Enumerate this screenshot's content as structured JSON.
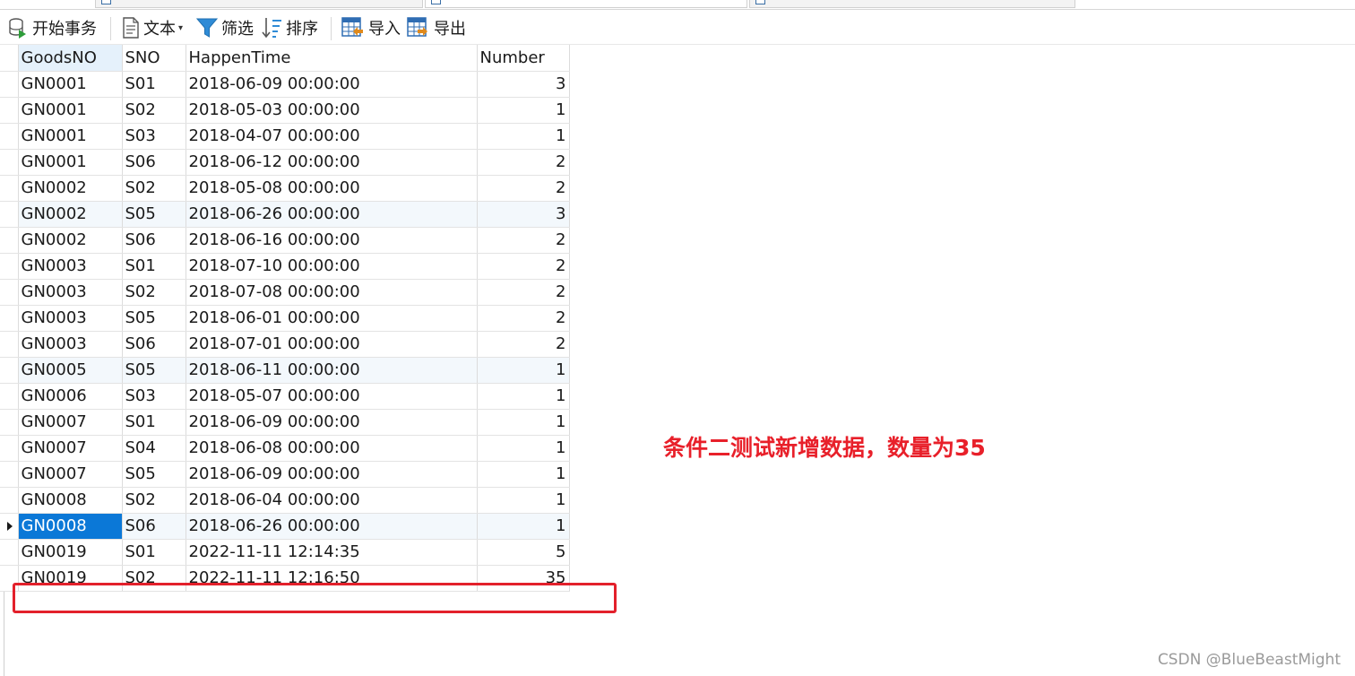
{
  "toolbar": {
    "begin_transaction": "开始事务",
    "text": "文本",
    "filter": "筛选",
    "sort": "排序",
    "import": "导入",
    "export": "导出"
  },
  "table": {
    "columns": [
      "GoodsNO",
      "SNO",
      "HappenTime",
      "Number"
    ],
    "rows": [
      [
        "GN0001",
        "S01",
        "2018-06-09 00:00:00",
        "3"
      ],
      [
        "GN0001",
        "S02",
        "2018-05-03 00:00:00",
        "1"
      ],
      [
        "GN0001",
        "S03",
        "2018-04-07 00:00:00",
        "1"
      ],
      [
        "GN0001",
        "S06",
        "2018-06-12 00:00:00",
        "2"
      ],
      [
        "GN0002",
        "S02",
        "2018-05-08 00:00:00",
        "2"
      ],
      [
        "GN0002",
        "S05",
        "2018-06-26 00:00:00",
        "3"
      ],
      [
        "GN0002",
        "S06",
        "2018-06-16 00:00:00",
        "2"
      ],
      [
        "GN0003",
        "S01",
        "2018-07-10 00:00:00",
        "2"
      ],
      [
        "GN0003",
        "S02",
        "2018-07-08 00:00:00",
        "2"
      ],
      [
        "GN0003",
        "S05",
        "2018-06-01 00:00:00",
        "2"
      ],
      [
        "GN0003",
        "S06",
        "2018-07-01 00:00:00",
        "2"
      ],
      [
        "GN0005",
        "S05",
        "2018-06-11 00:00:00",
        "1"
      ],
      [
        "GN0006",
        "S03",
        "2018-05-07 00:00:00",
        "1"
      ],
      [
        "GN0007",
        "S01",
        "2018-06-09 00:00:00",
        "1"
      ],
      [
        "GN0007",
        "S04",
        "2018-06-08 00:00:00",
        "1"
      ],
      [
        "GN0007",
        "S05",
        "2018-06-09 00:00:00",
        "1"
      ],
      [
        "GN0008",
        "S02",
        "2018-06-04 00:00:00",
        "1"
      ],
      [
        "GN0008",
        "S06",
        "2018-06-26 00:00:00",
        "1"
      ],
      [
        "GN0019",
        "S01",
        "2022-11-11 12:14:35",
        "5"
      ],
      [
        "GN0019",
        "S02",
        "2022-11-11 12:16:50",
        "35"
      ]
    ],
    "current_row_index": 17
  },
  "annotation": {
    "text": "条件二测试新增数据，数量为35",
    "color": "#e8202a"
  },
  "watermark": "CSDN @BlueBeastMight",
  "colors": {
    "selection": "#0b78d7",
    "highlight_box": "#e3202b",
    "alt_row": "#f3f8fc"
  }
}
